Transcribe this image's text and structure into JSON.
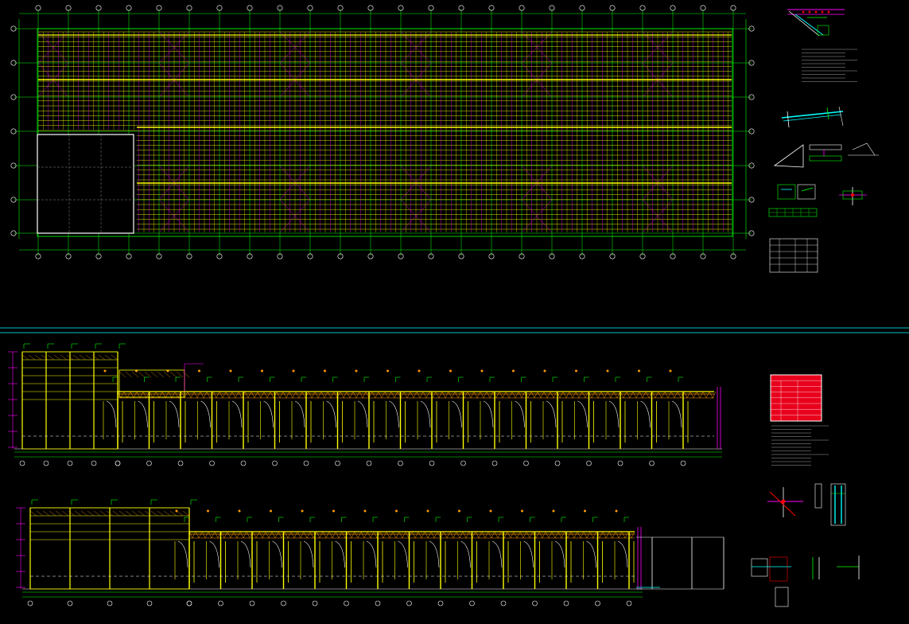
{
  "drawing": {
    "background": "#000000",
    "colors": {
      "axis": "#00ff00",
      "purlin": "#ffff00",
      "brace": "#ff00ff",
      "bubble": "#ffffff",
      "cyan": "#00ffff",
      "red": "#ff0000",
      "orange": "#ff9900",
      "table_red": "#e8001c"
    },
    "views": [
      {
        "id": "roof-plan",
        "kind": "plan"
      },
      {
        "id": "elevation-a",
        "kind": "elevation"
      },
      {
        "id": "elevation-b",
        "kind": "elevation"
      }
    ]
  }
}
